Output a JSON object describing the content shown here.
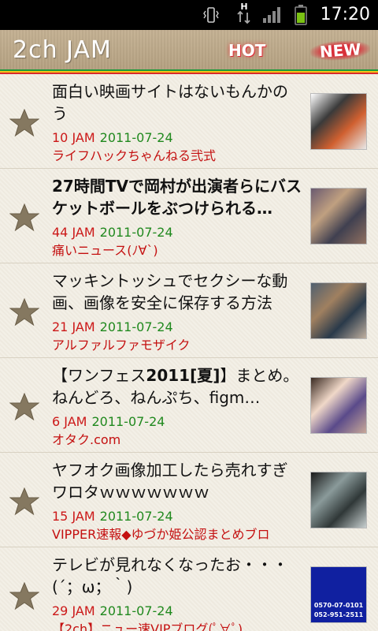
{
  "status_bar": {
    "time": "17:20",
    "icons": [
      "vibrate-icon",
      "ht-data-icon",
      "signal-icon",
      "battery-icon"
    ],
    "network_label": "H"
  },
  "header": {
    "app_title": "2ch JAM",
    "tabs": [
      {
        "label": "HOT",
        "active": false
      },
      {
        "label": "NEW",
        "active": true
      }
    ],
    "stripe_colors": [
      "#1b9b3a",
      "#f2c318",
      "#d92a2a"
    ]
  },
  "articles": [
    {
      "title": "面白い映画サイトはないもんかのう",
      "bold": false,
      "jam": "10 JAM",
      "date": "2011-07-24",
      "source": "ライフハックちゃんねる弐式",
      "thumb_colors": [
        "#ffffff",
        "#3a3a3a",
        "#d06030",
        "#e8e8e8"
      ]
    },
    {
      "title": "27時間TVで岡村が出演者らにバスケットボールをぶつけられる…",
      "bold": true,
      "jam": "44 JAM",
      "date": "2011-07-24",
      "source": "痛いニュース(ﾉ∀`)",
      "thumb_colors": [
        "#6a5a70",
        "#c0a080",
        "#404050",
        "#907060"
      ]
    },
    {
      "title": "マッキントッシュでセクシーな動画、画像を安全に保存する方法",
      "bold": false,
      "jam": "21 JAM",
      "date": "2011-07-24",
      "source": "アルファルファモザイク",
      "thumb_colors": [
        "#506070",
        "#a08060",
        "#2a3a4a",
        "#c0b0a0"
      ]
    },
    {
      "title": "【ワンフェス2011[夏]】まとめ。ねんどろ、ねんぷち、figm…",
      "bold_prefix": true,
      "bold": false,
      "jam": "6 JAM",
      "date": "2011-07-24",
      "source": "オタク.com",
      "thumb_colors": [
        "#3a2a22",
        "#f0d8c8",
        "#5a4a8a",
        "#c8a898"
      ]
    },
    {
      "title": "ヤフオク画像加工したら売れすぎワロタｗｗｗｗｗｗｗ",
      "bold": false,
      "jam": "15 JAM",
      "date": "2011-07-24",
      "source": "VIPPER速報◆ゆづか姫公認まとめブロ",
      "thumb_colors": [
        "#1a1a1a",
        "#8a9a9a",
        "#303838",
        "#c8d0d0"
      ]
    },
    {
      "title": "テレビが見れなくなったお・・・(´；ω；｀)",
      "bold": false,
      "jam": "29 JAM",
      "date": "2011-07-24",
      "source": "【2ch】ニュー速VIPブログ(ﾟ∀ﾟ)",
      "thumb_colors": [
        "#1020a0",
        "#ffffff",
        "#2030c0",
        "#e0e8ff"
      ],
      "thumb_text": [
        "0570-07-0101",
        "052-951-2511"
      ]
    }
  ]
}
